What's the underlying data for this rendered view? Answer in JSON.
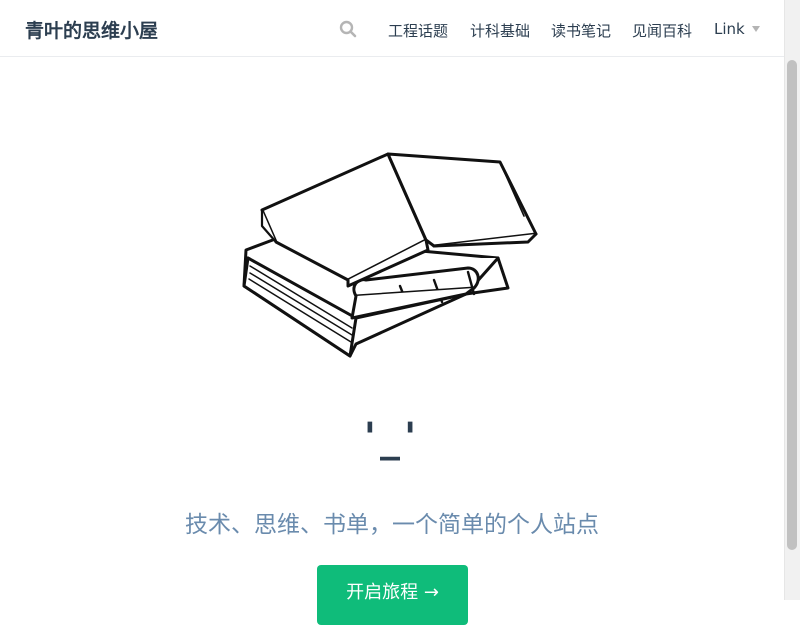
{
  "site": {
    "name": "青叶的思维小屋"
  },
  "nav": {
    "search_icon": "search-icon",
    "items": [
      {
        "label": "工程话题"
      },
      {
        "label": "计科基础"
      },
      {
        "label": "读书笔记"
      },
      {
        "label": "见闻百科"
      },
      {
        "label": "Link",
        "has_dropdown": true
      }
    ]
  },
  "hero": {
    "image": "book-stack-sketch",
    "title": "'_'",
    "description": "技术、思维、书单，一个简单的个人站点",
    "action_label": "开启旅程 →"
  },
  "colors": {
    "text": "#2c3e50",
    "description": "#6a8bad",
    "accent": "#0fbc7a",
    "border": "#eaecef"
  }
}
